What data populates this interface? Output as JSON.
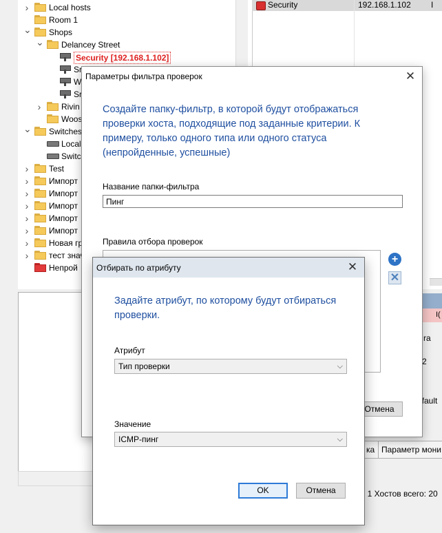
{
  "tree": {
    "items": [
      {
        "label": "Local hosts",
        "type": "folder",
        "indent": 0,
        "expander": "right"
      },
      {
        "label": "Room 1",
        "type": "folder",
        "indent": 0,
        "expander": "none"
      },
      {
        "label": "Shops",
        "type": "folder",
        "indent": 0,
        "expander": "down"
      },
      {
        "label": "Delancey Street",
        "type": "folder",
        "indent": 1,
        "expander": "down"
      },
      {
        "label": "Security [192.168.1.102]",
        "type": "camera",
        "indent": 2,
        "expander": "none",
        "selected": true
      },
      {
        "label": "Sr",
        "type": "camera",
        "indent": 2,
        "expander": "none"
      },
      {
        "label": "W",
        "type": "camera",
        "indent": 2,
        "expander": "none"
      },
      {
        "label": "Sr",
        "type": "camera",
        "indent": 2,
        "expander": "none"
      },
      {
        "label": "Rivin",
        "type": "folder",
        "indent": 1,
        "expander": "right"
      },
      {
        "label": "Woos",
        "type": "folder",
        "indent": 1,
        "expander": "none"
      },
      {
        "label": "Switches",
        "type": "folder",
        "indent": 0,
        "expander": "down"
      },
      {
        "label": "Local",
        "type": "switch",
        "indent": 1,
        "expander": "none"
      },
      {
        "label": "Switc",
        "type": "switch",
        "indent": 1,
        "expander": "none"
      },
      {
        "label": "Test",
        "type": "folder",
        "indent": 0,
        "expander": "right"
      },
      {
        "label": "Импорт",
        "type": "folder",
        "indent": 0,
        "expander": "right"
      },
      {
        "label": "Импорт",
        "type": "folder",
        "indent": 0,
        "expander": "right"
      },
      {
        "label": "Импорт",
        "type": "folder",
        "indent": 0,
        "expander": "right"
      },
      {
        "label": "Импорт",
        "type": "folder",
        "indent": 0,
        "expander": "right"
      },
      {
        "label": "Импорт",
        "type": "folder",
        "indent": 0,
        "expander": "right"
      },
      {
        "label": "Новая гр",
        "type": "folder",
        "indent": 0,
        "expander": "right"
      },
      {
        "label": "тест значе",
        "type": "folder",
        "indent": 0,
        "expander": "right"
      },
      {
        "label": "Непрой",
        "type": "folder-red",
        "indent": 0,
        "expander": "none"
      }
    ]
  },
  "right_list": {
    "row": {
      "name": "Security",
      "ip": "192.168.1.102",
      "extra": "I"
    }
  },
  "right_panel": {
    "pink_text": "I(",
    "text_1": "ra",
    "text_2": "2",
    "text_3": "efault"
  },
  "bottom_tabs": [
    "ка",
    "Параметр мони"
  ],
  "bottom_status": ": 1  Хостов всего: 20",
  "filter_dialog": {
    "title": "Параметры фильтра проверок",
    "description": "Создайте папку-фильтр, в которой будут отображаться проверки хоста, подходящие под заданные критерии. К примеру, только одного типа или одного статуса (непройденные, успешные)",
    "name_label": "Название папки-фильтра",
    "name_value": "Пинг",
    "rules_label": "Правила отбора проверок",
    "add_symbol": "+",
    "remove_symbol": "✕",
    "cancel_label": "Отмена"
  },
  "attr_dialog": {
    "title": "Отбирать по атрибуту",
    "description": "Задайте атрибут, по которому будут отбираться проверки.",
    "attribute_label": "Атрибут",
    "attribute_value": "Тип проверки",
    "value_label": "Значение",
    "value_value": "ICMP-пинг",
    "ok_label": "OK",
    "cancel_label": "Отмена"
  },
  "colors": {
    "accent_text": "#1f4fa0",
    "selected_text": "#e02020",
    "ok_border": "#2d7ad6",
    "folder": "#f5c95a"
  }
}
